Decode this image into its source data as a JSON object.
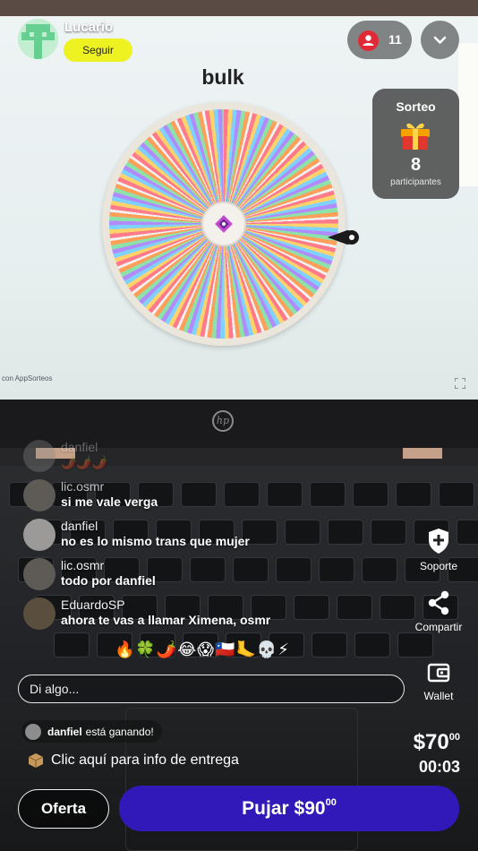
{
  "host": {
    "name": "Lucario",
    "follow_label": "Seguir",
    "viewer_count": "11"
  },
  "stream": {
    "wheel_title": "bulk",
    "brand_tag": "con  AppSorteos"
  },
  "raffle": {
    "title": "Sorteo",
    "count": "8",
    "label": "participantes"
  },
  "chat": [
    {
      "user": "danfiel",
      "message": "🌶️🌶️🌶️"
    },
    {
      "user": "lic.osmr",
      "message": "si me vale verga"
    },
    {
      "user": "danfiel",
      "message": "no es lo mismo trans que mujer"
    },
    {
      "user": "lic.osmr",
      "message": "todo por danfiel"
    },
    {
      "user": "EduardoSP",
      "message": "ahora te vas a llamar Ximena, osmr"
    }
  ],
  "reactions": "🔥🍀🌶️😂😱🇨🇱🦶💀⚡",
  "actions": {
    "support_label": "Soporte",
    "share_label": "Compartir",
    "wallet_label": "Wallet"
  },
  "comment": {
    "placeholder": "Di algo..."
  },
  "winner": {
    "name": "danfiel",
    "status": "está ganando!"
  },
  "delivery_text": "Clic aquí para info de entrega",
  "auction": {
    "price_main": "$70",
    "price_cents": "00",
    "timer": "00:03",
    "offer_label": "Oferta",
    "bid_main": "Pujar $90",
    "bid_cents": "00"
  },
  "colors": {
    "follow": "#eef221",
    "bid": "#3019b8",
    "viewer_badge": "#e22a36"
  }
}
